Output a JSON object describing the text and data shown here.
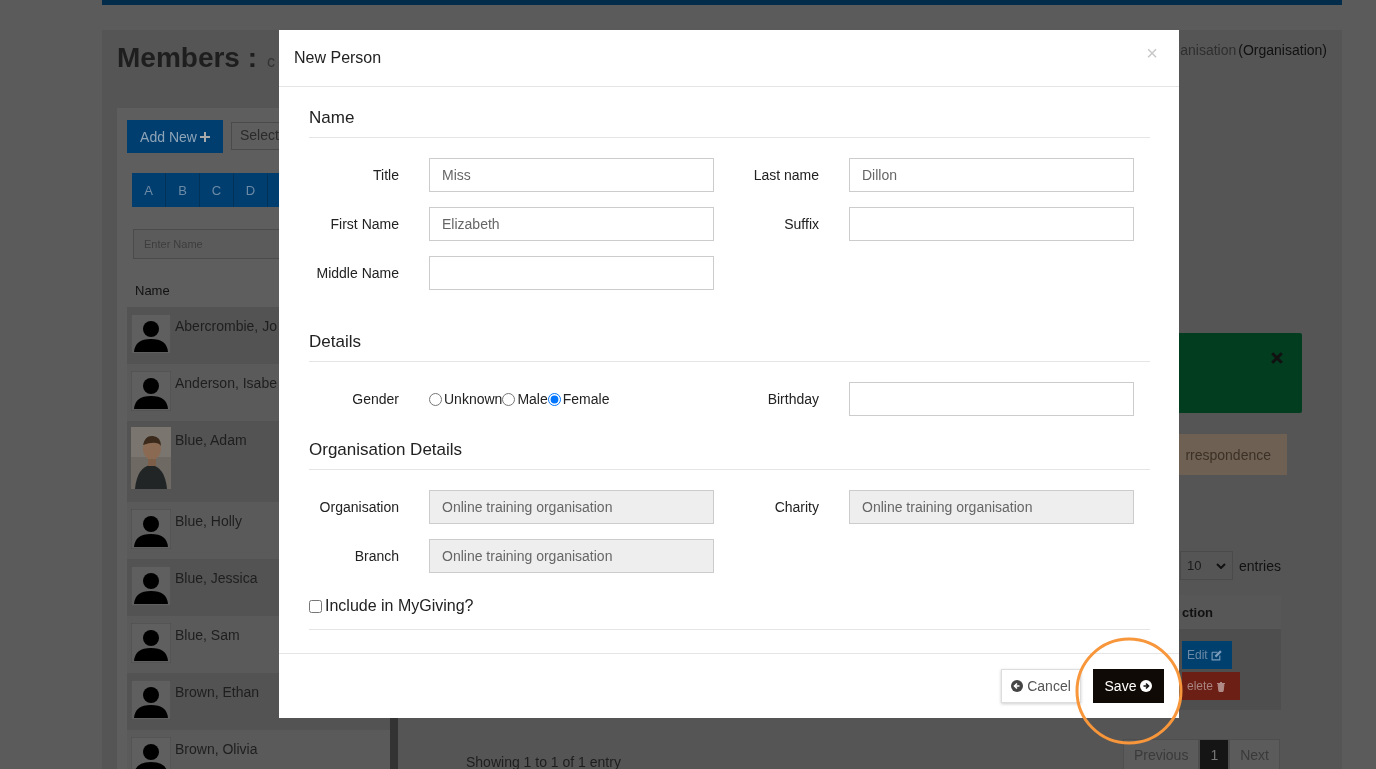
{
  "page": {
    "title": "Members :",
    "subtitle": "c",
    "breadcrumb_muted": "anisation",
    "breadcrumb": "(Organisation)"
  },
  "toolbar": {
    "add_button": "Add New",
    "select": "Select"
  },
  "letters": [
    "A",
    "B",
    "C",
    "D"
  ],
  "search": {
    "placeholder": "Enter Name"
  },
  "members_table": {
    "header": "Name",
    "rows": [
      {
        "name": "Abercrombie, Jo",
        "kind": "silhouette"
      },
      {
        "name": "Anderson, Isabe",
        "kind": "silhouette"
      },
      {
        "name": "Blue, Adam",
        "kind": "picture"
      },
      {
        "name": "Blue, Holly",
        "kind": "silhouette"
      },
      {
        "name": "Blue, Jessica",
        "kind": "silhouette"
      },
      {
        "name": "Blue, Sam",
        "kind": "silhouette"
      },
      {
        "name": "Brown, Ethan",
        "kind": "silhouette"
      },
      {
        "name": "Brown, Olivia",
        "kind": "silhouette"
      }
    ]
  },
  "correspondence_button": "rrespondence",
  "entries": {
    "value": "10",
    "label": "entries"
  },
  "actions_table": {
    "header": "ction",
    "buttons": [
      {
        "label": "Edit",
        "kind": "edit"
      },
      {
        "label": "elete",
        "kind": "delete"
      }
    ]
  },
  "info": "Showing 1 to 1 of 1 entry",
  "pagination": [
    {
      "label": "Previous",
      "selected": false
    },
    {
      "label": "1",
      "selected": true
    },
    {
      "label": "Next",
      "selected": false
    }
  ],
  "modal": {
    "title": "New Person",
    "close": "×",
    "sections": [
      {
        "heading": "Name",
        "fields": [
          {
            "label": "Title",
            "kind": "text",
            "value": "Miss"
          },
          {
            "label": "Last name",
            "kind": "text",
            "value": "Dillon"
          },
          {
            "label": "First Name",
            "kind": "text",
            "value": "Elizabeth"
          },
          {
            "label": "Suffix",
            "kind": "text"
          },
          {
            "label": "Middle Name",
            "kind": "text"
          }
        ]
      },
      {
        "heading": "Details",
        "fields": [
          {
            "label": "Gender",
            "kind": "radio",
            "options": [
              {
                "label": "Unknown",
                "selected": false
              },
              {
                "label": "Male",
                "selected": false
              },
              {
                "label": "Female",
                "selected": true
              }
            ]
          },
          {
            "label": "Birthday",
            "kind": "text"
          }
        ]
      },
      {
        "heading": "Organisation Details",
        "fields": [
          {
            "label": "Organisation",
            "kind": "readonly",
            "value": "Online training organisation"
          },
          {
            "label": "Charity",
            "kind": "readonly",
            "value": "Online training organisation"
          },
          {
            "label": "Branch",
            "kind": "readonly",
            "value": "Online training organisation"
          }
        ]
      }
    ],
    "checkbox": {
      "label": "Include in MyGiving?",
      "checked": false
    },
    "buttons": [
      {
        "label": "Cancel",
        "kind": "cancel"
      },
      {
        "label": "Save",
        "kind": "save"
      }
    ]
  }
}
